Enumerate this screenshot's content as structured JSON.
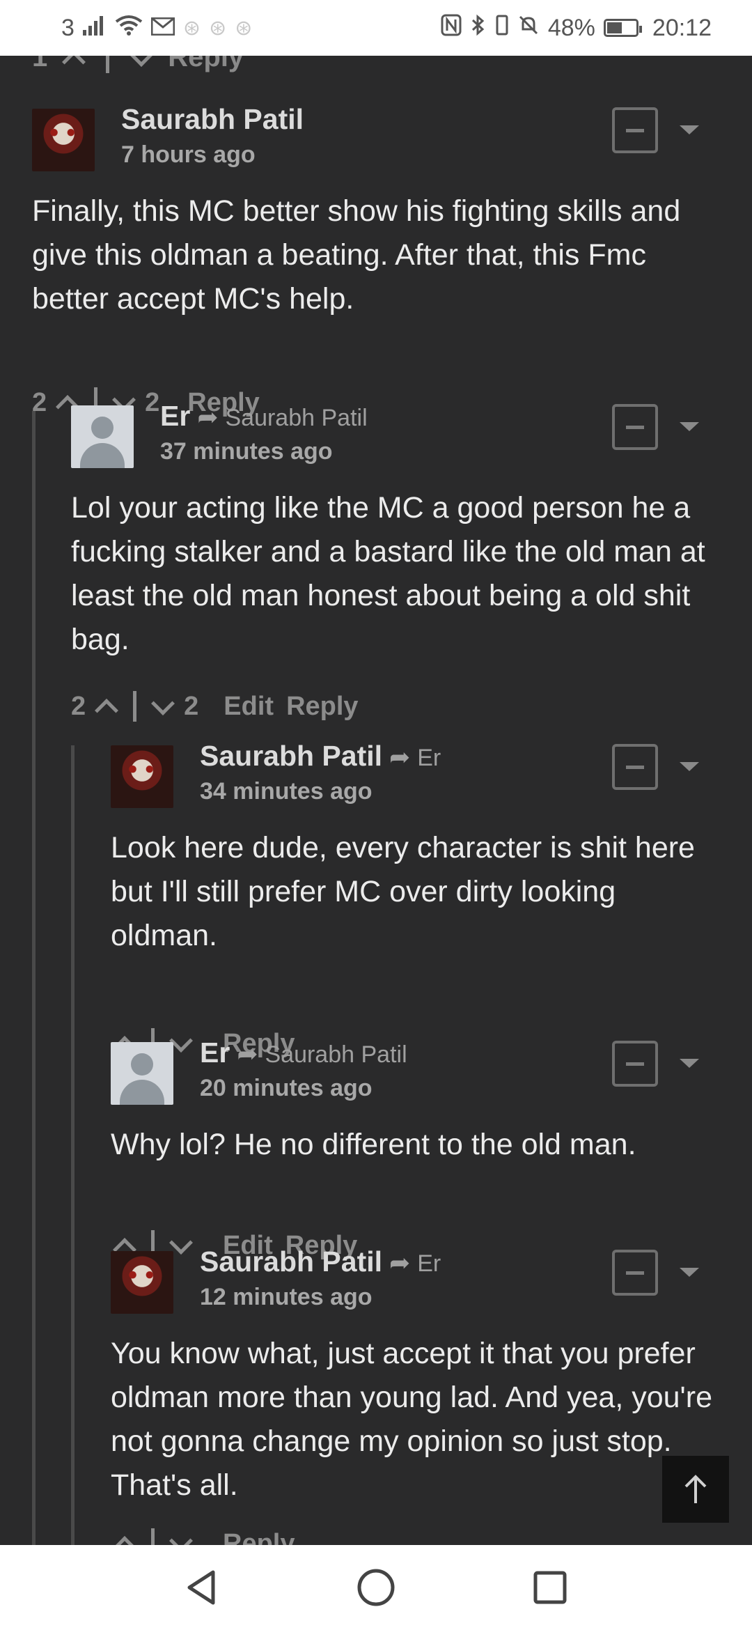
{
  "status_bar": {
    "carrier": "3",
    "battery": "48%",
    "time": "20:12"
  },
  "previous_actions": {
    "votes_up": "1",
    "reply_label": "Reply"
  },
  "comments": [
    {
      "author": "Saurabh Patil",
      "reply_to": "",
      "time": "7 hours ago",
      "avatar": "anime-avatar",
      "text": "Finally, this MC better show his fighting skills and give this oldman a beating. After that, this Fmc better accept MC's help.",
      "upvotes": "2",
      "downvotes": "2",
      "edit_label": "",
      "reply_label": "Reply"
    },
    {
      "author": "Er",
      "reply_to": "Saurabh Patil",
      "time": "37 minutes ago",
      "avatar": "default-avatar",
      "text": "Lol your acting like the MC a good person he a fucking stalker and a bastard like the old man at least the old man honest about being a old shit bag.",
      "upvotes": "2",
      "downvotes": "2",
      "edit_label": "Edit",
      "reply_label": "Reply"
    },
    {
      "author": "Saurabh Patil",
      "reply_to": "Er",
      "time": "34 minutes ago",
      "avatar": "anime-avatar",
      "text": "Look here dude, every character is shit here but I'll still prefer MC over dirty looking oldman.",
      "upvotes": "",
      "downvotes": "",
      "edit_label": "",
      "reply_label": "Reply"
    },
    {
      "author": "Er",
      "reply_to": "Saurabh Patil",
      "time": "20 minutes ago",
      "avatar": "default-avatar",
      "text": "Why lol? He no different to the old man.",
      "upvotes": "",
      "downvotes": "",
      "edit_label": "Edit",
      "reply_label": "Reply"
    },
    {
      "author": "Saurabh Patil",
      "reply_to": "Er",
      "time": "12 minutes ago",
      "avatar": "anime-avatar",
      "text": "You know what, just accept it that you prefer oldman more than young lad. And yea, you're not gonna change my opinion so just stop. That's all.",
      "upvotes": "",
      "downvotes": "",
      "edit_label": "",
      "reply_label": "Reply"
    }
  ]
}
